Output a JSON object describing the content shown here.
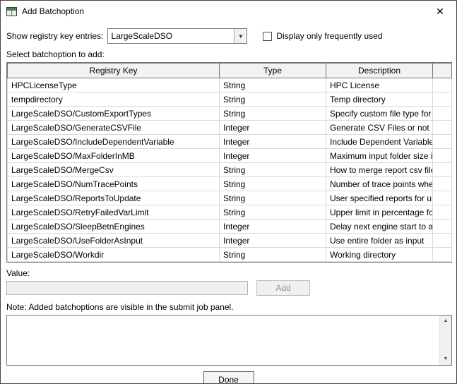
{
  "window": {
    "title": "Add Batchoption"
  },
  "icons": {
    "close": "✕",
    "dropdown_arrow": "▼",
    "scroll_up": "▲",
    "scroll_down": "▼"
  },
  "controls": {
    "registry_label": "Show registry key entries:",
    "registry_selected": "LargeScaleDSO",
    "frequent_checkbox_label": "Display only frequently used",
    "frequent_checkbox_checked": false,
    "select_label": "Select batchoption to add:",
    "value_label": "Value:",
    "value_input": "",
    "add_button": "Add",
    "note_label": "Note: Added batchoptions are visible in the submit job panel.",
    "note_text": "",
    "done_button": "Done"
  },
  "table": {
    "headers": [
      "Registry Key",
      "Type",
      "Description",
      ""
    ],
    "rows": [
      {
        "key": "HPCLicenseType",
        "type": "String",
        "desc": "HPC License"
      },
      {
        "key": "tempdirectory",
        "type": "String",
        "desc": "Temp directory"
      },
      {
        "key": "LargeScaleDSO/CustomExportTypes",
        "type": "String",
        "desc": "Specify custom file type for ..."
      },
      {
        "key": "LargeScaleDSO/GenerateCSVFile",
        "type": "Integer",
        "desc": "Generate CSV Files or not"
      },
      {
        "key": "LargeScaleDSO/IncludeDependentVariable",
        "type": "Integer",
        "desc": "Include Dependent Variable ..."
      },
      {
        "key": "LargeScaleDSO/MaxFolderInMB",
        "type": "Integer",
        "desc": "Maximum input folder size in..."
      },
      {
        "key": "LargeScaleDSO/MergeCsv",
        "type": "String",
        "desc": "How to merge report csv files"
      },
      {
        "key": "LargeScaleDSO/NumTracePoints",
        "type": "String",
        "desc": "Number of trace points whe..."
      },
      {
        "key": "LargeScaleDSO/ReportsToUpdate",
        "type": "String",
        "desc": "User specified reports for u..."
      },
      {
        "key": "LargeScaleDSO/RetryFailedVarLimit",
        "type": "String",
        "desc": "Upper limit in percentage fo..."
      },
      {
        "key": "LargeScaleDSO/SleepBetnEngines",
        "type": "Integer",
        "desc": "Delay next engine start to a..."
      },
      {
        "key": "LargeScaleDSO/UseFolderAsInput",
        "type": "Integer",
        "desc": "Use entire folder as input"
      },
      {
        "key": "LargeScaleDSO/Workdir",
        "type": "String",
        "desc": "Working directory"
      }
    ]
  }
}
